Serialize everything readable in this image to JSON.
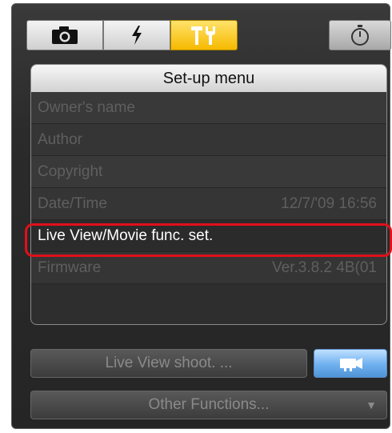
{
  "tabs": {
    "camera_icon": "camera-icon",
    "flash_icon": "flash-icon",
    "setup_icon": "wrench-icon",
    "timer_icon": "stopwatch-icon",
    "active_color": "#f6b900"
  },
  "menu": {
    "title": "Set-up menu",
    "items": [
      {
        "label": "Owner's name",
        "value": ""
      },
      {
        "label": "Author",
        "value": ""
      },
      {
        "label": "Copyright",
        "value": ""
      },
      {
        "label": "Date/Time",
        "value": "12/7/'09  16:56"
      },
      {
        "label": "Live View/Movie func. set.",
        "value": ""
      },
      {
        "label": "Firmware",
        "value": "Ver.3.8.2 4B(01"
      }
    ]
  },
  "buttons": {
    "live_view_label": "Live View shoot. ...",
    "movie_icon": "movie-camera-icon",
    "other_functions_label": "Other Functions...",
    "dropdown_arrow": "▼"
  },
  "highlight_color": "#e0101a"
}
